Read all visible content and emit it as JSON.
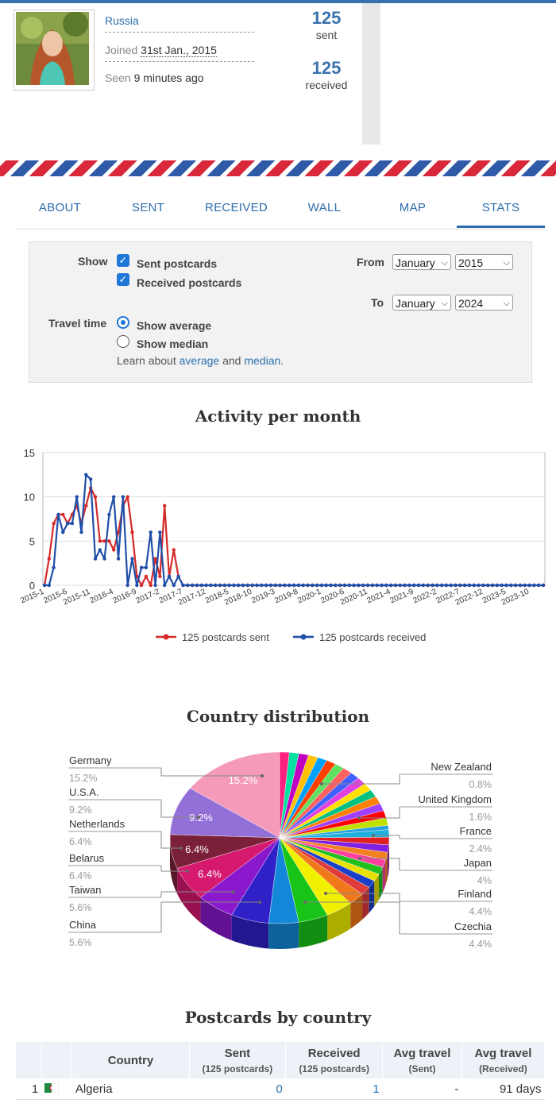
{
  "profile": {
    "country": "Russia",
    "joined_label": "Joined",
    "joined_date": "31st Jan., 2015",
    "seen_label": "Seen",
    "seen_value": "9 minutes ago",
    "sent_count": "125",
    "sent_label": "sent",
    "received_count": "125",
    "received_label": "received"
  },
  "tabs": [
    {
      "label": "ABOUT"
    },
    {
      "label": "SENT"
    },
    {
      "label": "RECEIVED"
    },
    {
      "label": "WALL"
    },
    {
      "label": "MAP"
    },
    {
      "label": "STATS",
      "active": true
    }
  ],
  "filters": {
    "show_label": "Show",
    "sent_option": "Sent postcards",
    "sent_checked": true,
    "received_option": "Received postcards",
    "received_checked": true,
    "travel_label": "Travel time",
    "average_option": "Show average",
    "median_option": "Show median",
    "selected_travel": "average",
    "learn_text": "Learn about",
    "learn_and": "and",
    "learn_average": "average",
    "learn_median": "median",
    "from_label": "From",
    "from_month": "January",
    "from_year": "2015",
    "to_label": "To",
    "to_month": "January",
    "to_year": "2024"
  },
  "chart_data": [
    {
      "type": "line",
      "title": "Activity per month",
      "ylim": [
        0,
        15
      ],
      "yticks": [
        "0",
        "5",
        "10",
        "15"
      ],
      "xticks": [
        "2015-1",
        "2015-6",
        "2015-11",
        "2016-4",
        "2016-9",
        "2017-2",
        "2017-7",
        "2017-12",
        "2018-5",
        "2018-10",
        "2019-3",
        "2019-8",
        "2020-1",
        "2020-6",
        "2020-11",
        "2021-4",
        "2021-9",
        "2022-2",
        "2022-7",
        "2022-12",
        "2023-5",
        "2023-10"
      ],
      "month_count": 109,
      "grid": true,
      "legend_position": "bottom",
      "series": [
        {
          "name": "125 postcards sent",
          "color": "#d42a2a",
          "values": [
            0,
            3,
            7,
            8,
            8,
            7,
            8,
            9,
            7,
            9,
            11,
            10,
            5,
            5,
            5,
            4,
            6,
            9,
            10,
            6,
            1,
            0,
            1,
            0,
            3,
            1,
            9,
            1,
            4,
            1,
            0,
            0,
            0,
            0,
            0,
            0,
            0,
            0,
            0,
            0,
            0,
            0,
            0,
            0,
            0,
            0,
            0,
            0,
            0,
            0,
            0,
            0,
            0,
            0,
            0,
            0,
            0,
            0,
            0,
            0,
            0,
            0,
            0,
            0,
            0,
            0,
            0,
            0,
            0,
            0,
            0,
            0,
            0,
            0,
            0,
            0,
            0,
            0,
            0,
            0,
            0,
            0,
            0,
            0,
            0,
            0,
            0,
            0,
            0,
            0,
            0,
            0,
            0,
            0,
            0,
            0,
            0,
            0,
            0,
            0,
            0,
            0,
            0,
            0,
            0,
            0,
            0,
            0,
            0
          ]
        },
        {
          "name": "125 postcards received",
          "color": "#1f4fa8",
          "values": [
            0,
            0,
            2,
            8,
            6,
            7,
            7,
            10,
            6,
            12.5,
            12,
            3,
            4,
            3,
            8,
            10,
            3,
            10,
            0,
            3,
            0,
            2,
            2,
            6,
            0,
            6,
            0,
            1,
            0,
            1,
            0,
            0,
            0,
            0,
            0,
            0,
            0,
            0,
            0,
            0,
            0,
            0,
            0,
            0,
            0,
            0,
            0,
            0,
            0,
            0,
            0,
            0,
            0,
            0,
            0,
            0,
            0,
            0,
            0,
            0,
            0,
            0,
            0,
            0,
            0,
            0,
            0,
            0,
            0,
            0,
            0,
            0,
            0,
            0,
            0,
            0,
            0,
            0,
            0,
            0,
            0,
            0,
            0,
            0,
            0,
            0,
            0,
            0,
            0,
            0,
            0,
            0,
            0,
            0,
            0,
            0,
            0,
            0,
            0,
            0,
            0,
            0,
            0,
            0,
            0,
            0,
            0,
            0,
            0
          ]
        }
      ]
    },
    {
      "type": "pie",
      "title": "Country distribution",
      "labeled_slices": [
        {
          "name": "Germany",
          "pct": "15.2%",
          "value": 15.2,
          "color": "#f59ab8"
        },
        {
          "name": "U.S.A.",
          "pct": "9.2%",
          "value": 9.2,
          "color": "#9370d8"
        },
        {
          "name": "Netherlands",
          "pct": "6.4%",
          "value": 6.4,
          "color": "#7a2038"
        },
        {
          "name": "Belarus",
          "pct": "6.4%",
          "value": 6.4,
          "color": "#d4196e"
        },
        {
          "name": "Taiwan",
          "pct": "5.6%",
          "value": 5.6,
          "color": "#8a18cc"
        },
        {
          "name": "China",
          "pct": "5.6%",
          "value": 5.6,
          "color": "#3020c8"
        },
        {
          "name": "Czechia",
          "pct": "4.4%",
          "value": 4.4,
          "color": "#1488d8"
        },
        {
          "name": "Finland",
          "pct": "4.4%",
          "value": 4.4,
          "color": "#18c418"
        },
        {
          "name": "Japan",
          "pct": "4%",
          "value": 4.0,
          "color": "#f0f000"
        },
        {
          "name": "France",
          "pct": "2.4%",
          "value": 2.4,
          "color": "#f07818"
        },
        {
          "name": "United Kingdom",
          "pct": "1.6%",
          "value": 1.6,
          "color": "#e03c3c"
        },
        {
          "name": "New Zealand",
          "pct": "0.8%",
          "value": 0.8,
          "color": "#28a0e0"
        }
      ],
      "small_slice_colors": [
        "#1840c8",
        "#e8e000",
        "#20c020",
        "#ff40a0",
        "#f08020",
        "#8020e0",
        "#e02020",
        "#20b0e0",
        "#c0e000",
        "#ff0000",
        "#a040ff",
        "#ff8000",
        "#00c080",
        "#ffe000",
        "#e040e0",
        "#4060ff",
        "#ff6060",
        "#60e060",
        "#ff4000",
        "#00a0ff",
        "#ffc000",
        "#c000c0",
        "#00e0a0",
        "#ff2080"
      ]
    }
  ],
  "table": {
    "title": "Postcards by country",
    "headers": {
      "country": "Country",
      "sent": "Sent",
      "sent_sub": "(125 postcards)",
      "received": "Received",
      "received_sub": "(125 postcards)",
      "avg_sent": "Avg travel",
      "avg_sent_sub": "(Sent)",
      "avg_received": "Avg travel",
      "avg_received_sub": "(Received)"
    },
    "rows": [
      {
        "rank": "1",
        "country": "Algeria",
        "sent": "0",
        "received": "1",
        "avg_sent": "-",
        "avg_received": "91 days"
      }
    ]
  }
}
